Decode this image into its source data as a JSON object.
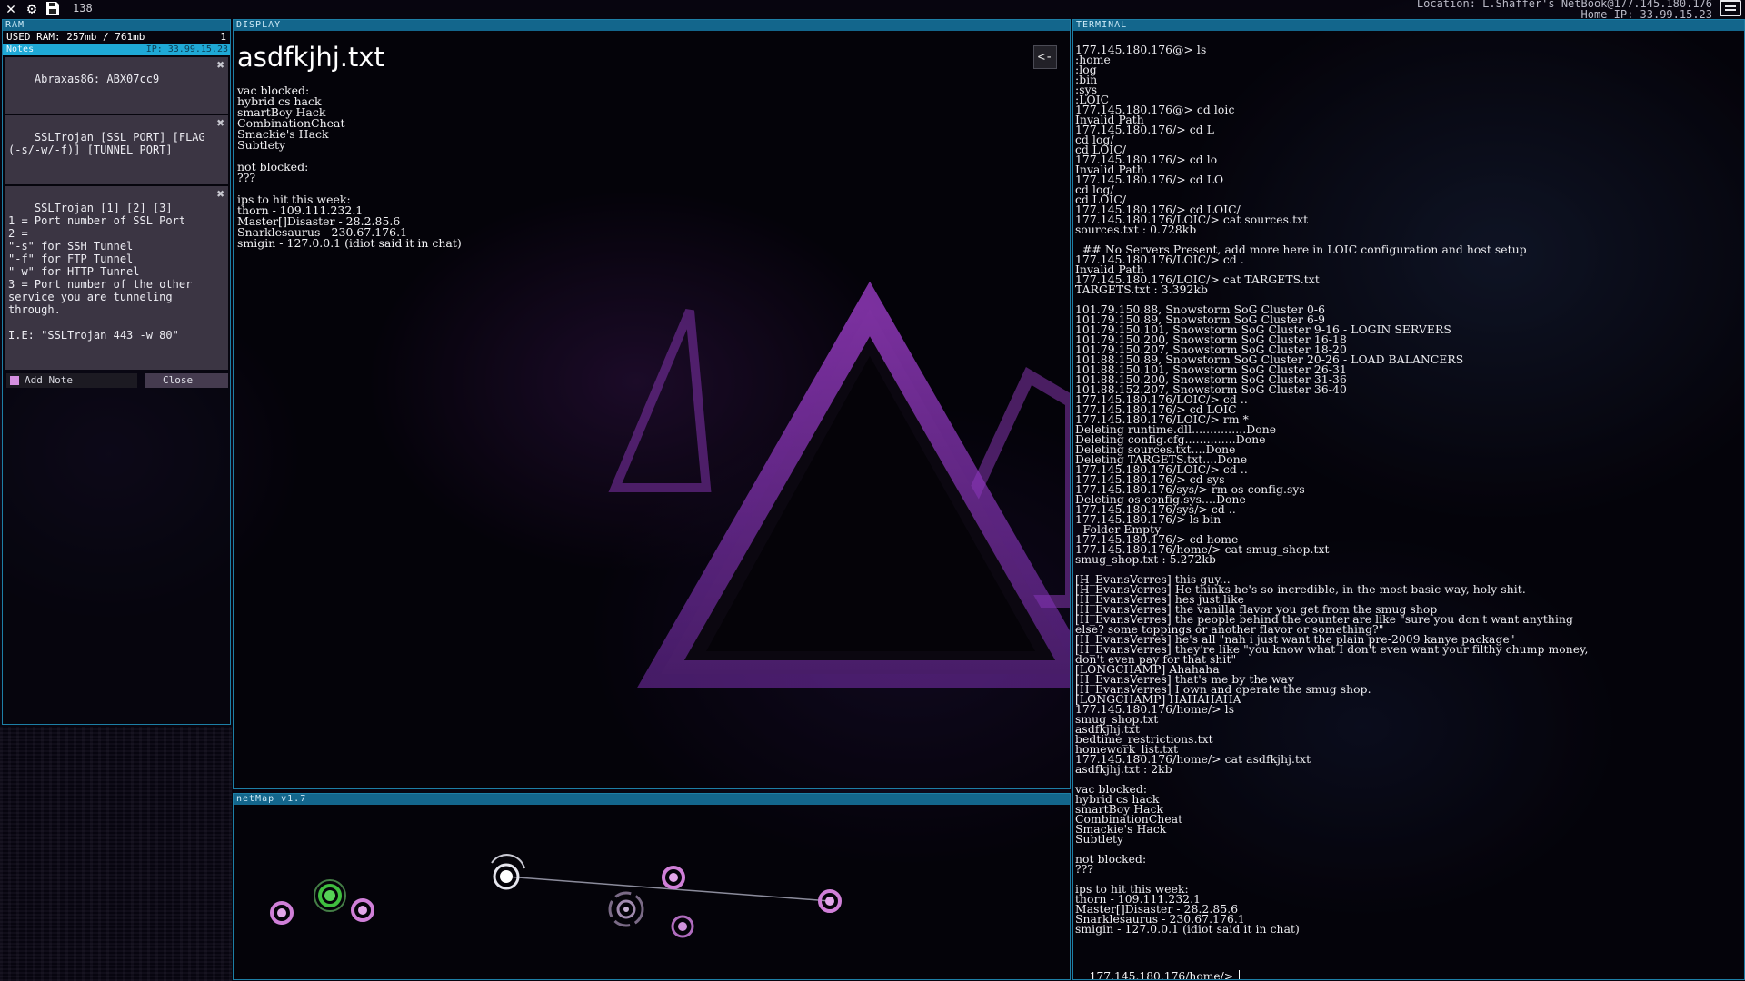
{
  "topbar": {
    "icons": [
      "close-icon",
      "gear-icon",
      "save-icon"
    ],
    "count": "138",
    "location": "Location: L.Shaffer's NetBook@177.145.180.176",
    "home_ip": "Home IP: 33.99.15.23"
  },
  "ram": {
    "header": "RAM",
    "used_label": "USED RAM: 257mb / 761mb",
    "used_fraction": 0.338,
    "used_count": "1",
    "notes_label": "Notes",
    "notes_ip": "IP: 33.99.15.23",
    "notes": [
      "Abraxas86: ABX07cc9",
      "SSLTrojan [SSL PORT] [FLAG\n(-s/-w/-f)] [TUNNEL PORT]",
      "SSLTrojan [1] [2] [3]\n1 = Port number of SSL Port\n2 =\n\"-s\" for SSH Tunnel\n\"-f\" for FTP Tunnel\n\"-w\" for HTTP Tunnel\n3 = Port number of the other\nservice you are tunneling\nthrough.\n\nI.E: \"SSLTrojan 443 -w 80\""
    ],
    "add_note_label": "Add Note",
    "close_label": "Close",
    "add_note_color": "#d58fe0"
  },
  "display": {
    "header": "DISPLAY",
    "title": "asdfkjhj.txt",
    "back_label": "<-",
    "content": "vac blocked:\nhybrid cs hack\nsmartBoy Hack\nCombinationCheat\nSmackie's Hack\nSubtlety\n\nnot blocked:\n???\n\nips to hit this week:\nthorn - 109.111.232.1\nMaster[]Disaster - 28.2.85.6\nSnarklesaurus - 230.67.176.1\nsmigin - 127.0.0.1 (idiot said it in chat)"
  },
  "netmap": {
    "header": "netMap v1.7",
    "nodes": [
      {
        "name": "node-1",
        "type": "pink"
      },
      {
        "name": "node-home",
        "type": "green"
      },
      {
        "name": "node-2",
        "type": "pink"
      },
      {
        "name": "node-current",
        "type": "white"
      },
      {
        "name": "node-3",
        "type": "purple-ring"
      },
      {
        "name": "node-4",
        "type": "pink"
      },
      {
        "name": "node-5",
        "type": "pink-small"
      },
      {
        "name": "node-6",
        "type": "pink"
      }
    ]
  },
  "terminal": {
    "header": "TERMINAL",
    "lines": [
      "177.145.180.176@> ls",
      ":home",
      ":log",
      ":bin",
      ":sys",
      ":LOIC",
      "177.145.180.176@> cd loic",
      "Invalid Path",
      "177.145.180.176/> cd L",
      "cd log/",
      "cd LOIC/",
      "177.145.180.176/> cd lo",
      "Invalid Path",
      "177.145.180.176/> cd LO",
      "cd log/",
      "cd LOIC/",
      "177.145.180.176/> cd LOIC/",
      "177.145.180.176/LOIC/> cat sources.txt",
      "sources.txt : 0.728kb",
      "",
      "  ## No Servers Present, add more here in LOIC configuration and host setup",
      "177.145.180.176/LOIC/> cd .",
      "Invalid Path",
      "177.145.180.176/LOIC/> cat TARGETS.txt",
      "TARGETS.txt : 3.392kb",
      "",
      "101.79.150.88, Snowstorm SoG Cluster 0-6",
      "101.79.150.89, Snowstorm SoG Cluster 6-9",
      "101.79.150.101, Snowstorm SoG Cluster 9-16 - LOGIN SERVERS",
      "101.79.150.200, Snowstorm SoG Cluster 16-18",
      "101.79.150.207, Snowstorm SoG Cluster 18-20",
      "101.88.150.89, Snowstorm SoG Cluster 20-26 - LOAD BALANCERS",
      "101.88.150.101, Snowstorm SoG Cluster 26-31",
      "101.88.150.200, Snowstorm SoG Cluster 31-36",
      "101.88.152.207, Snowstorm SoG Cluster 36-40",
      "177.145.180.176/LOIC/> cd ..",
      "177.145.180.176/> cd LOIC",
      "177.145.180.176/LOIC/> rm *",
      "Deleting runtime.dll...............Done",
      "Deleting config.cfg..............Done",
      "Deleting sources.txt....Done",
      "Deleting TARGETS.txt....Done",
      "177.145.180.176/LOIC/> cd ..",
      "177.145.180.176/> cd sys",
      "177.145.180.176/sys/> rm os-config.sys",
      "Deleting os-config.sys....Done",
      "177.145.180.176/sys/> cd ..",
      "177.145.180.176/> ls bin",
      "--Folder Empty --",
      "177.145.180.176/> cd home",
      "177.145.180.176/home/> cat smug_shop.txt",
      "smug_shop.txt : 5.272kb",
      "",
      "[H_EvansVerres] this guy...",
      "[H_EvansVerres] He thinks he's so incredible, in the most basic way, holy shit.",
      "[H_EvansVerres] hes just like",
      "[H_EvansVerres] the vanilla flavor you get from the smug shop",
      "[H_EvansVerres] the people behind the counter are like \"sure you don't want anything",
      "else? some toppings or another flavor or something?\"",
      "[H_EvansVerres] he's all \"nah i just want the plain pre-2009 kanye package\"",
      "[H_EvansVerres] they're like \"you know what I don't even want your filthy chump money,",
      "don't even pay for that shit\"",
      "[LONGCHAMP] Ahahaha",
      "[H_EvansVerres] that's me by the way",
      "[H_EvansVerres] I own and operate the smug shop.",
      "[LONGCHAMP] HAHAHAHA",
      "177.145.180.176/home/> ls",
      "smug_shop.txt",
      "asdfkjhj.txt",
      "bedtime_restrictions.txt",
      "homework_list.txt",
      "177.145.180.176/home/> cat asdfkjhj.txt",
      "asdfkjhj.txt : 2kb",
      "",
      "vac blocked:",
      "hybrid cs hack",
      "smartBoy Hack",
      "CombinationCheat",
      "Smackie's Hack",
      "Subtlety",
      "",
      "not blocked:",
      "???",
      "",
      "ips to hit this week:",
      "thorn - 109.111.232.1",
      "Master[]Disaster - 28.2.85.6",
      "Snarklesaurus - 230.67.176.1",
      "smigin - 127.0.0.1 (idiot said it in chat)"
    ],
    "prompt": "177.145.180.176/home/>"
  }
}
